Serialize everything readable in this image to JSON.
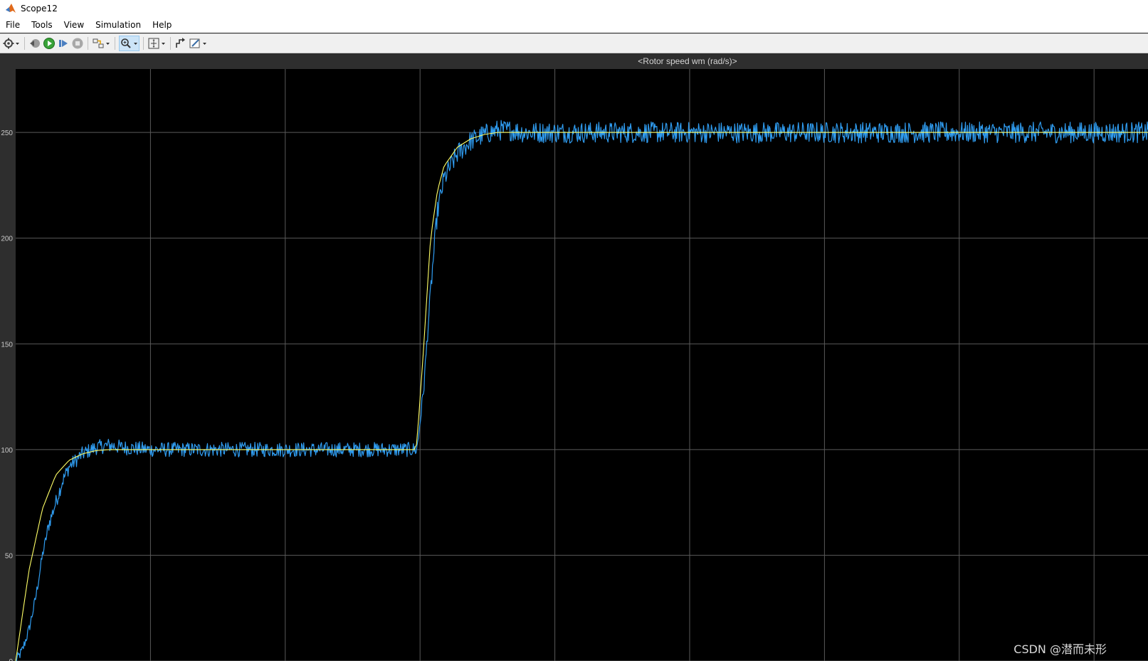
{
  "window": {
    "title": "Scope12"
  },
  "menu": [
    "File",
    "Tools",
    "View",
    "Simulation",
    "Help"
  ],
  "toolbar": [
    {
      "icon": "gear-icon"
    },
    {
      "icon": "step-back-icon"
    },
    {
      "icon": "run-icon"
    },
    {
      "icon": "step-forward-icon"
    },
    {
      "icon": "stop-icon"
    },
    {
      "icon": "highlight-simulink-block-icon"
    },
    {
      "icon": "zoom-icon"
    },
    {
      "icon": "fit-to-view-icon"
    },
    {
      "icon": "signal-selector-icon"
    },
    {
      "icon": "style-icon"
    }
  ],
  "colors": {
    "plot_background": "#000000",
    "axes_background": "#2e2e2e",
    "grid": "#5a5a5a",
    "reference": "#ffff66",
    "measured": "#2f9cf0"
  },
  "watermark": "CSDN @潜而未形",
  "chart_data": {
    "type": "line",
    "title": "<Rotor speed wm (rad/s)>",
    "ylim": [
      0,
      280
    ],
    "yticks": [
      "0",
      "50",
      "100",
      "150",
      "200",
      "250"
    ],
    "grid": true,
    "series": [
      {
        "name": "",
        "color": "#ffff66",
        "x": [
          0,
          0.1,
          0.2,
          0.3,
          0.4,
          0.5,
          0.6,
          0.7,
          0.8,
          1.0,
          1.2,
          1.5,
          2.0,
          2.5,
          2.99,
          3.0,
          3.05,
          3.1,
          3.15,
          3.2,
          3.3,
          3.4,
          3.5,
          3.6,
          3.7,
          3.8,
          4.0,
          4.5,
          6.0,
          8.46
        ],
        "values": [
          0,
          43,
          72,
          88,
          95,
          98,
          99.5,
          100,
          100,
          100,
          100,
          100,
          100,
          100,
          100,
          105,
          150,
          200,
          222,
          234,
          243,
          247,
          249,
          250,
          250,
          250,
          250,
          250,
          250,
          250
        ]
      },
      {
        "name": "",
        "color": "#2f9cf0",
        "x": [
          0,
          0.05,
          0.1,
          0.15,
          0.2,
          0.25,
          0.3,
          0.35,
          0.4,
          0.5,
          0.6,
          0.7,
          0.8,
          1.0,
          1.5,
          2.0,
          2.5,
          2.99,
          3.0,
          3.05,
          3.1,
          3.15,
          3.2,
          3.3,
          3.4,
          3.5,
          3.6,
          3.7,
          3.8,
          4.0,
          4.5,
          6.0,
          8.46
        ],
        "values": [
          0,
          5,
          15,
          30,
          50,
          65,
          75,
          85,
          92,
          98,
          101,
          102,
          101,
          100,
          100,
          100,
          100,
          100,
          101,
          130,
          175,
          212,
          228,
          240,
          246,
          249,
          251,
          251,
          250,
          250,
          250,
          250,
          250
        ]
      }
    ]
  }
}
